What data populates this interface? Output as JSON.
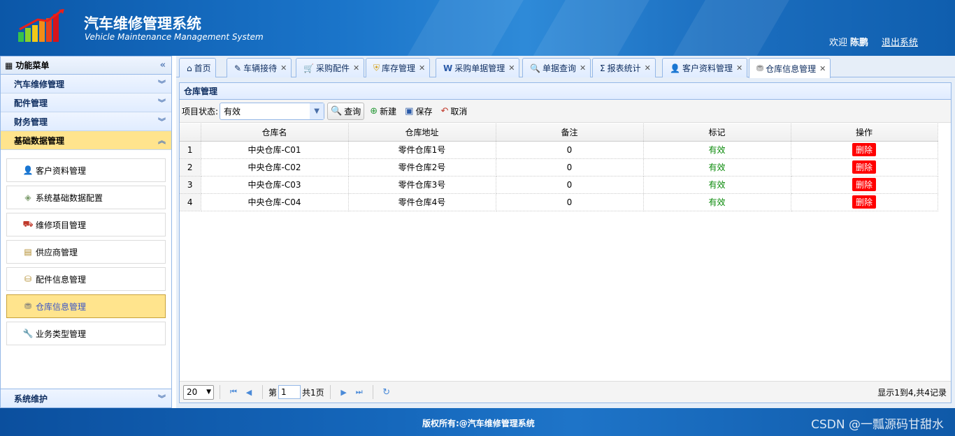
{
  "header": {
    "title_cn": "汽车维修管理系统",
    "title_en": "Vehicle Maintenance Management System",
    "welcome": "欢迎",
    "user": "陈鹏",
    "logout": "退出系统"
  },
  "sidebar": {
    "title": "功能菜单",
    "sections": [
      "汽车维修管理",
      "配件管理",
      "财务管理",
      "基础数据管理"
    ],
    "items": [
      {
        "label": "客户资料管理",
        "icon": "user-icon"
      },
      {
        "label": "系统基础数据配置",
        "icon": "tag-icon"
      },
      {
        "label": "维修项目管理",
        "icon": "car-icon"
      },
      {
        "label": "供应商管理",
        "icon": "document-icon"
      },
      {
        "label": "配件信息管理",
        "icon": "parts-icon"
      },
      {
        "label": "仓库信息管理",
        "icon": "warehouse-icon"
      },
      {
        "label": "业务类型管理",
        "icon": "wrench-icon"
      }
    ],
    "bottom_section": "系统维护"
  },
  "tabs": [
    {
      "label": "首页",
      "icon": "home-icon"
    },
    {
      "label": "车辆接待",
      "icon": "edit-icon"
    },
    {
      "label": "采购配件",
      "icon": "cart-icon"
    },
    {
      "label": "库存管理",
      "icon": "shield-icon"
    },
    {
      "label": "采购单据管理",
      "icon": "word-icon"
    },
    {
      "label": "单据查询",
      "icon": "search-icon"
    },
    {
      "label": "报表统计",
      "icon": "sigma-icon"
    },
    {
      "label": "客户资料管理",
      "icon": "user-icon"
    },
    {
      "label": "仓库信息管理",
      "icon": "warehouse-icon"
    }
  ],
  "panel": {
    "title": "仓库管理",
    "status_label": "项目状态:",
    "status_value": "有效",
    "buttons": {
      "query": "查询",
      "new": "新建",
      "save": "保存",
      "cancel": "取消"
    }
  },
  "table": {
    "columns": [
      "仓库名",
      "仓库地址",
      "备注",
      "标记",
      "操作"
    ],
    "rows": [
      {
        "no": "1",
        "name": "中央仓库-C01",
        "address": "零件仓库1号",
        "remark": "0",
        "flag": "有效",
        "action": "删除"
      },
      {
        "no": "2",
        "name": "中央仓库-C02",
        "address": "零件仓库2号",
        "remark": "0",
        "flag": "有效",
        "action": "删除"
      },
      {
        "no": "3",
        "name": "中央仓库-C03",
        "address": "零件仓库3号",
        "remark": "0",
        "flag": "有效",
        "action": "删除"
      },
      {
        "no": "4",
        "name": "中央仓库-C04",
        "address": "零件仓库4号",
        "remark": "0",
        "flag": "有效",
        "action": "删除"
      }
    ]
  },
  "pager": {
    "page_size": "20",
    "page_prefix": "第",
    "page_value": "1",
    "page_suffix": "共1页",
    "info": "显示1到4,共4记录"
  },
  "footer": {
    "copyright": "版权所有:@汽车维修管理系统",
    "watermark": "CSDN @一瓢源码甘甜水"
  }
}
